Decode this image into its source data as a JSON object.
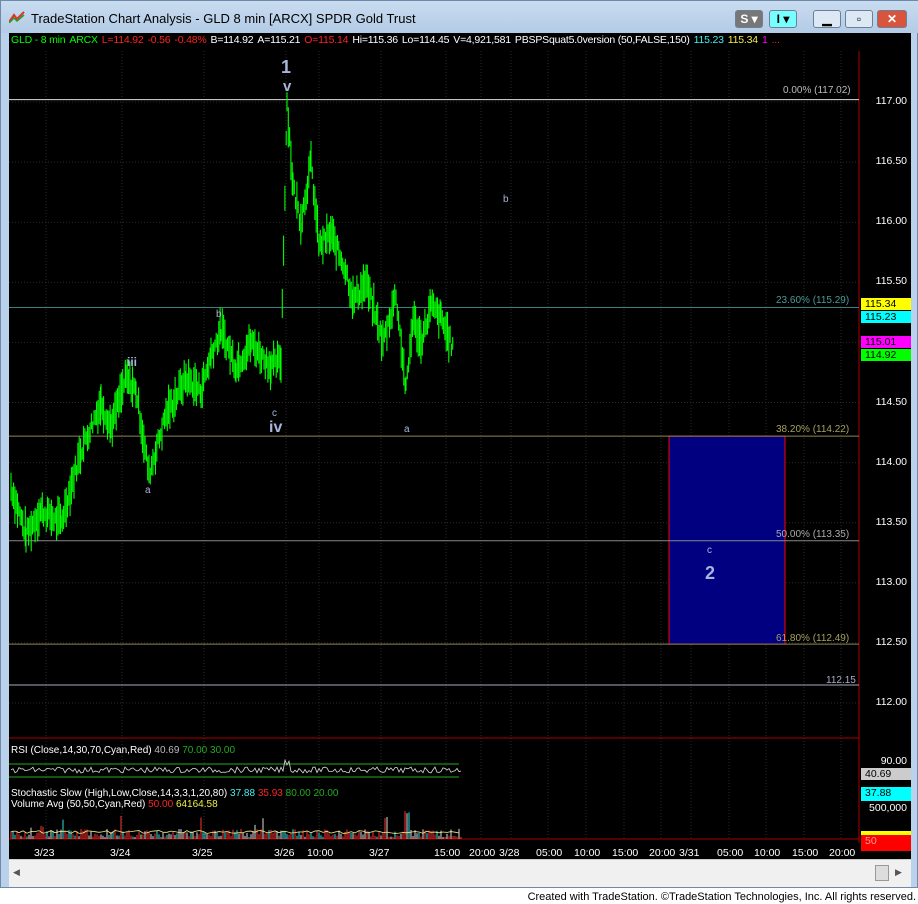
{
  "window": {
    "title": "TradeStation Chart Analysis - GLD 8 min [ARCX] SPDR Gold Trust",
    "btn_s": "S",
    "btn_i": "I"
  },
  "info": {
    "symbol": "GLD - 8 min",
    "exchange": "ARCX",
    "last": "L=114.92",
    "chg": "-0.56",
    "pct": "-0.48%",
    "bid": "B=114.92",
    "ask": "A=115.21",
    "open": "O=115.14",
    "high": "Hi=115.36",
    "low": "Lo=114.45",
    "vol": "V=4,921,581",
    "study": "PBSPSquat5.0version (50,FALSE,150)",
    "v1": "115.23",
    "v2": "115.34",
    "v3": "1",
    "more": "..."
  },
  "price_axis": [
    "117.00",
    "116.50",
    "116.00",
    "115.50",
    "115.00",
    "114.50",
    "114.00",
    "113.50",
    "113.00",
    "112.50",
    "112.00"
  ],
  "price_tags": {
    "yellow": "115.34",
    "cyan": "115.23",
    "magenta": "115.01",
    "green": "114.92"
  },
  "fib": {
    "f0": "0.00% (117.02)",
    "f236": "23.60% (115.29)",
    "f382": "38.20% (114.22)",
    "f50": "50.00% (113.35)",
    "f618": "61.80% (112.49)",
    "level": "112.15"
  },
  "waves": {
    "w1": "1",
    "v": "v",
    "iii": "iii",
    "b1": "b",
    "a1": "a",
    "c1": "c",
    "iv": "iv",
    "b2": "b",
    "a2": "a",
    "c2": "c",
    "w2": "2"
  },
  "rsi": {
    "label": "RSI (Close,14,30,70,Cyan,Red)",
    "value": "40.69",
    "ob": "70.00",
    "os": "30.00",
    "axis": "90.00",
    "tag": "40.69"
  },
  "stoch": {
    "label": "Stochastic Slow (High,Low,Close,14,3,3,1,20,80)",
    "k": "37.88",
    "d": "35.93",
    "ob": "80.00",
    "os": "20.00",
    "tag": "37.88"
  },
  "volume": {
    "label": "Volume Avg (50,50,Cyan,Red)",
    "v1": "50.00",
    "v2": "64164.58",
    "axis": "500,000",
    "tag": "50"
  },
  "time_axis": [
    "3/23",
    "3/24",
    "3/25",
    "3/26",
    "10:00",
    "3/27",
    "15:00",
    "20:00",
    "3/28",
    "05:00",
    "10:00",
    "15:00",
    "20:00",
    "3/31",
    "05:00",
    "10:00",
    "15:00",
    "20:00"
  ],
  "colors": {
    "bars": "#00ff00",
    "box": "#000080",
    "box_border": "#ff0000"
  },
  "credit": "Created with TradeStation. ©TradeStation Technologies, Inc. All rights reserved."
}
